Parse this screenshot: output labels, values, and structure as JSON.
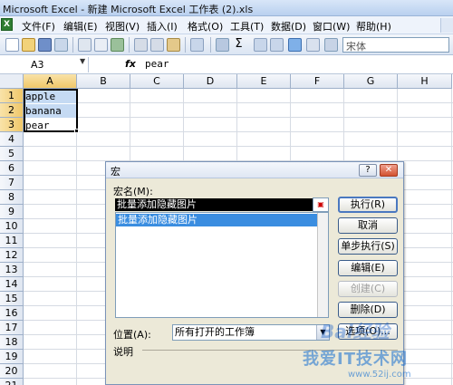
{
  "window": {
    "title": "Microsoft Excel - 新建 Microsoft Excel 工作表 (2).xls"
  },
  "menu": {
    "items": [
      "文件(F)",
      "编辑(E)",
      "视图(V)",
      "插入(I)",
      "格式(O)",
      "工具(T)",
      "数据(D)",
      "窗口(W)",
      "帮助(H)"
    ]
  },
  "toolbar": {
    "font_name": "宋体"
  },
  "formula_bar": {
    "name_box": "A3",
    "fx_label": "fx",
    "value": "pear"
  },
  "sheet": {
    "columns": [
      "A",
      "B",
      "C",
      "D",
      "E",
      "F",
      "G",
      "H"
    ],
    "rows": [
      "1",
      "2",
      "3",
      "4",
      "5",
      "6",
      "7",
      "8",
      "9",
      "10",
      "11",
      "12",
      "13",
      "14",
      "15",
      "16",
      "17",
      "18",
      "19",
      "20",
      "21"
    ],
    "cells": {
      "A1": "apple",
      "A2": "banana",
      "A3": "pear"
    }
  },
  "dialog": {
    "title": "宏",
    "help_btn": "?",
    "close_btn": "✕",
    "macro_name_label": "宏名(M):",
    "macro_name_value": "批量添加隐藏图片",
    "macro_list": [
      "批量添加隐藏图片"
    ],
    "buttons": [
      "执行(R)",
      "取消",
      "单步执行(S)",
      "编辑(E)",
      "创建(C)",
      "删除(D)",
      "选项(O)..."
    ],
    "location_label": "位置(A):",
    "location_value": "所有打开的工作簿",
    "description_label": "说明"
  },
  "watermark": {
    "brand": "我爱IT技术网",
    "url": "www.52ij.com",
    "logo": "Bai经验"
  }
}
